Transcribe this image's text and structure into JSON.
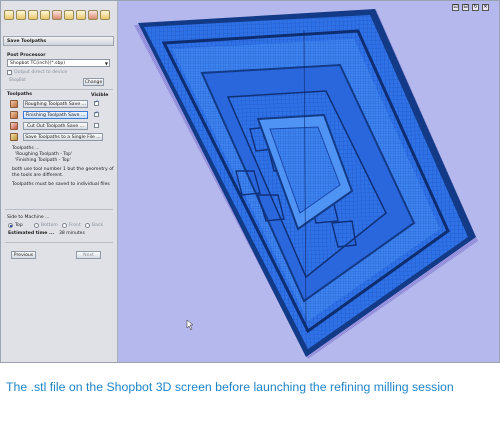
{
  "panel": {
    "header": "Save Toolpaths",
    "post_processor": {
      "section_label": "Post Processor",
      "selected": "Shopbot TC(inch)(*.sbp)",
      "output_direct_label": "Output direct to device",
      "machine_value": "ShopBot",
      "change_label": "Change"
    },
    "toolpaths": {
      "section_label": "Toolpaths",
      "visible_label": "Visible",
      "items": [
        {
          "label": "Roughing Toolpath Save ...",
          "visible": true
        },
        {
          "label": "Finishing Toolpath Save ...",
          "visible": true
        },
        {
          "label": "Cut Out Toolpath Save ...",
          "visible": false
        }
      ],
      "save_single_label": "Save Toolpaths to a Single File ..."
    },
    "note": {
      "line1": "Toolpaths ...",
      "line2": "'Roughing Toolpath - Top'",
      "line3": "'Finishing Toolpath - Top'",
      "line4": "both use tool number 1 but the geometry of",
      "line5": "the tools are different.",
      "line6": "Toolpaths must be saved to individual files"
    },
    "side": {
      "label": "Side to Machine ...",
      "options": [
        "Top",
        "Bottom",
        "Front",
        "Back"
      ],
      "selected": "Top",
      "estimated_label": "Estimated time ...",
      "estimated_value": "38 minutes"
    },
    "previous_label": "Previous",
    "next_label": "Next"
  },
  "view_controls": [
    "⊡",
    "⊟",
    "↻",
    "✕"
  ],
  "caption": "The .stl file on the Shopbot 3D screen before launching the refining milling session",
  "colors": {
    "panel_bg": "#dfe1e6",
    "view_bg": "#b4b8ec",
    "mesh_blue": "#2f72e8",
    "mesh_dark": "#123a86",
    "caption": "#1f84c8"
  }
}
